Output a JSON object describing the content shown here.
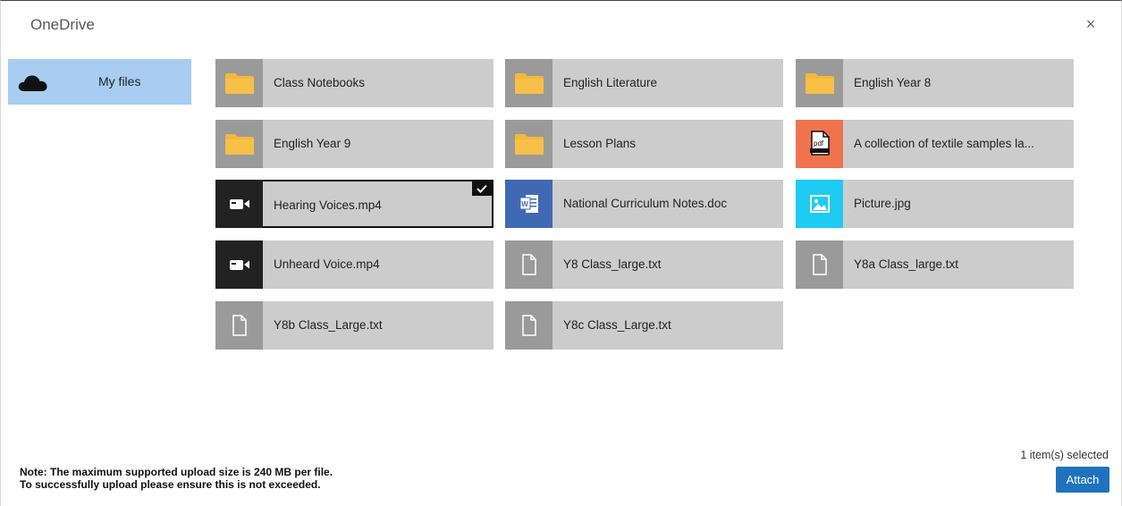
{
  "dialog": {
    "title": "OneDrive",
    "close_label": "×"
  },
  "sidebar": {
    "items": [
      {
        "label": "My files",
        "icon": "onedrive-cloud-icon",
        "selected": true
      }
    ]
  },
  "files": [
    {
      "name": "Class Notebooks",
      "type": "folder",
      "icon": "folder-icon"
    },
    {
      "name": "English Literature",
      "type": "folder",
      "icon": "folder-icon"
    },
    {
      "name": "English Year 8",
      "type": "folder",
      "icon": "folder-icon"
    },
    {
      "name": "English Year 9",
      "type": "folder",
      "icon": "folder-icon"
    },
    {
      "name": "Lesson Plans",
      "type": "folder",
      "icon": "folder-icon"
    },
    {
      "name": "A collection of textile samples la...",
      "type": "pdf",
      "icon": "pdf-icon"
    },
    {
      "name": "Hearing Voices.mp4",
      "type": "video",
      "icon": "video-icon",
      "selected": true
    },
    {
      "name": "National Curriculum Notes.doc",
      "type": "doc",
      "icon": "word-icon"
    },
    {
      "name": "Picture.jpg",
      "type": "image",
      "icon": "image-icon"
    },
    {
      "name": "Unheard Voice.mp4",
      "type": "video",
      "icon": "video-icon"
    },
    {
      "name": "Y8 Class_large.txt",
      "type": "txt",
      "icon": "document-icon"
    },
    {
      "name": "Y8a Class_large.txt",
      "type": "txt",
      "icon": "document-icon"
    },
    {
      "name": "Y8b Class_Large.txt",
      "type": "txt",
      "icon": "document-icon"
    },
    {
      "name": "Y8c Class_Large.txt",
      "type": "txt",
      "icon": "document-icon"
    }
  ],
  "footer": {
    "note_line1": "Note: The maximum supported upload size is 240 MB per file.",
    "note_line2": "To successfully upload please ensure this is not exceeded.",
    "selection_status": "1 item(s) selected",
    "attach_label": "Attach"
  },
  "colors": {
    "sidebar_selected": "#a8cdf0",
    "tile_background": "#cccccc",
    "attach_button": "#1e73be",
    "pdf": "#f0734e",
    "word": "#3f6ab3",
    "image": "#1ecbf2",
    "video": "#222222",
    "folder": "#f5b83a"
  }
}
